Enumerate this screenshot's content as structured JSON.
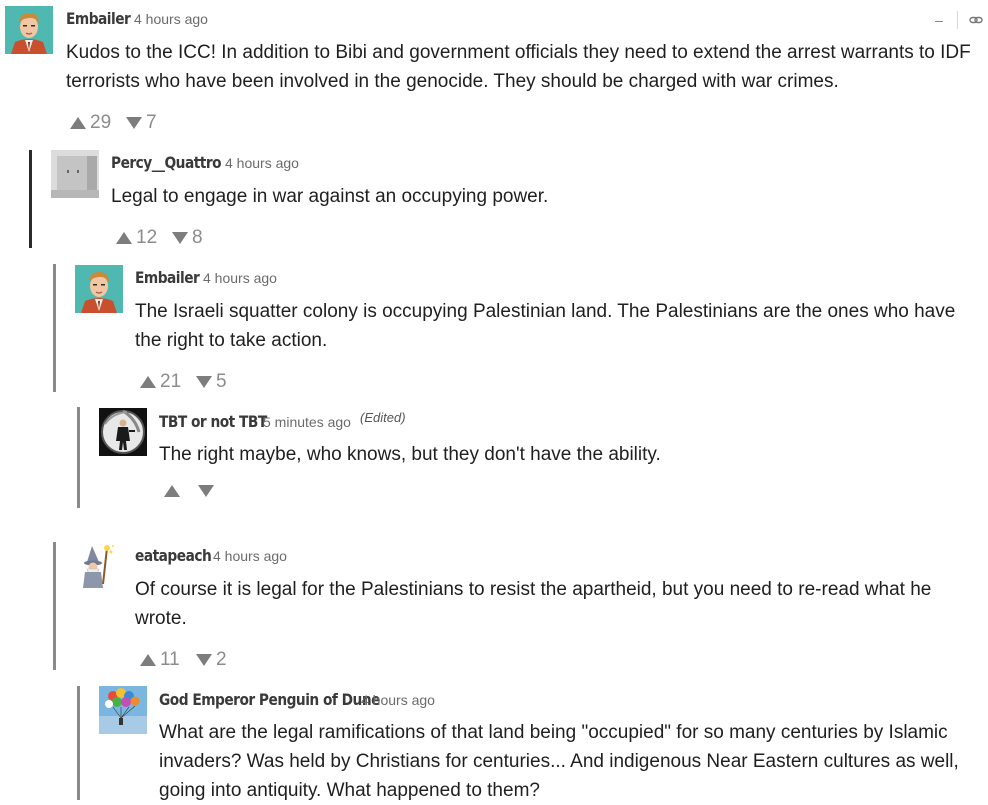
{
  "toolbar": {
    "collapse_glyph": "–",
    "link_icon": "link-icon"
  },
  "comments": [
    {
      "author": "Embailer",
      "time": "4 hours ago",
      "text": "Kudos to the ICC! In addition to Bibi and government officials they need to extend the arrest warrants to IDF terrorists who have been involved in the genocide. They should be charged with war crimes.",
      "upvotes": "29",
      "downvotes": "7",
      "avatar": "man-in-suit-avatar"
    },
    {
      "author": "Percy__Quattro",
      "time": "4 hours ago",
      "text": "Legal to engage in war against an occupying power.",
      "upvotes": "12",
      "downvotes": "8",
      "avatar": "gray-box-avatar"
    },
    {
      "author": "Embailer",
      "time": "4 hours ago",
      "text": "The Israeli squatter colony is occupying Palestinian land. The Palestinians are the ones who have the right to take action.",
      "upvotes": "21",
      "downvotes": "5",
      "avatar": "man-in-suit-avatar"
    },
    {
      "author": "TBT or not TBT",
      "time": "5 minutes ago",
      "edited": "(Edited)",
      "text": "The right maybe, who knows, but they don't have the ability.",
      "upvotes": "",
      "downvotes": "",
      "avatar": "gun-barrel-avatar"
    },
    {
      "author": "eatapeach",
      "time": "4 hours ago",
      "text": "Of course it is legal for the Palestinians to resist the apartheid, but you need to re-read what he wrote.",
      "upvotes": "11",
      "downvotes": "2",
      "avatar": "wizard-avatar"
    },
    {
      "author": "God Emperor Penguin of Dune",
      "time": "4 hours ago",
      "text": "What are the legal ramifications of that land being \"occupied\" for so many centuries by Islamic invaders? Was held by Christians for centuries... And indigenous Near Eastern cultures as well, going into antiquity. What happened to them?",
      "upvotes": "",
      "downvotes": "",
      "avatar": "balloons-avatar"
    }
  ]
}
